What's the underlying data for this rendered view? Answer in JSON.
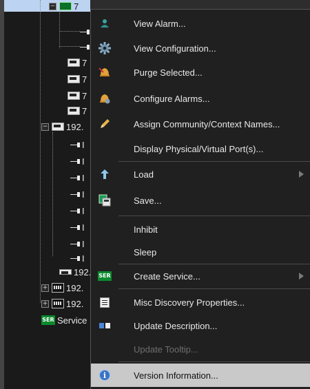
{
  "tree": {
    "selected_row_label": "7",
    "devices": [
      {
        "label": "7"
      },
      {
        "label": "7"
      },
      {
        "label": "7"
      },
      {
        "label": "7"
      }
    ],
    "host_label": "192.",
    "port_label": "I",
    "hosts_bottom": [
      {
        "label": "192."
      },
      {
        "label": "192."
      },
      {
        "label": "192."
      }
    ],
    "service_label": "Service",
    "ser_badge": "SER",
    "collapse_glyph": "−",
    "expand_glyph": "+"
  },
  "context_menu": {
    "items": [
      {
        "label": "View Alarm...",
        "icon": "alarm-person-icon"
      },
      {
        "label": "View Configuration...",
        "icon": "gear-icon"
      },
      {
        "label": "Purge Selected...",
        "icon": "bell-purge-icon"
      },
      {
        "label": "Configure Alarms...",
        "icon": "bell-config-icon"
      },
      {
        "label": "Assign Community/Context Names...",
        "icon": "pencil-icon"
      },
      {
        "label": "Display Physical/Virtual Port(s)...",
        "icon": ""
      },
      {
        "label": "Load",
        "icon": "upload-arrow-icon",
        "submenu": true
      },
      {
        "label": "Save...",
        "icon": "save-disk-icon"
      },
      {
        "label": "Inhibit",
        "icon": ""
      },
      {
        "label": "Sleep",
        "icon": ""
      },
      {
        "label": "Create Service...",
        "icon": "service-icon",
        "submenu": true,
        "badge": "SER"
      },
      {
        "label": "Misc Discovery Properties...",
        "icon": "properties-doc-icon"
      },
      {
        "label": "Update Description...",
        "icon": "description-icon"
      },
      {
        "label": "Update Tooltip...",
        "icon": "",
        "disabled": true
      },
      {
        "label": "Version Information...",
        "icon": "info-icon",
        "selected": true,
        "glyph": "i"
      }
    ]
  },
  "colors": {
    "menu_background": "#202020",
    "selected_background": "#c9c9c9",
    "tree_selection": "#bcd4f2",
    "service_green": "#0b8a2e"
  }
}
